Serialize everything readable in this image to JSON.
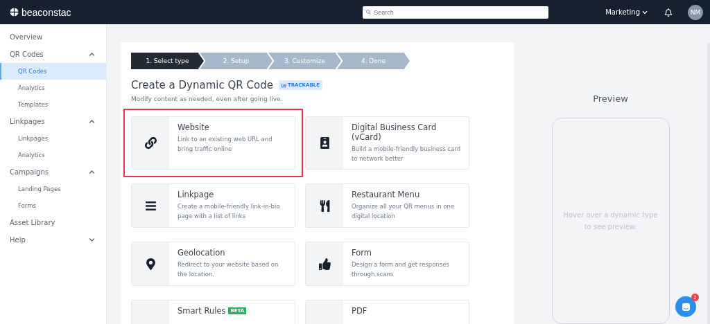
{
  "header": {
    "logo": "beaconstac",
    "search": {
      "placeholder": "Search"
    },
    "workspace": "Marketing",
    "avatar": "NM"
  },
  "sidebar": {
    "items": [
      {
        "label": "Overview"
      },
      {
        "label": "QR Codes",
        "expanded": true,
        "children": [
          {
            "label": "QR Codes",
            "selected": true
          },
          {
            "label": "Analytics",
            "selected": false
          },
          {
            "label": "Templates",
            "selected": false
          }
        ]
      },
      {
        "label": "Linkpages",
        "expanded": true,
        "children": [
          {
            "label": "Linkpages",
            "selected": false
          },
          {
            "label": "Analytics",
            "selected": false
          }
        ]
      },
      {
        "label": "Campaigns",
        "expanded": true,
        "children": [
          {
            "label": "Landing Pages",
            "selected": false
          },
          {
            "label": "Forms",
            "selected": false
          }
        ]
      },
      {
        "label": "Asset Library"
      },
      {
        "label": "Help",
        "expanded": false
      }
    ]
  },
  "steps": [
    {
      "label": "1. Select type",
      "selected": true
    },
    {
      "label": "2. Setup",
      "selected": false
    },
    {
      "label": "3. Customize",
      "selected": false
    },
    {
      "label": "4. Done",
      "selected": false
    }
  ],
  "title": "Create a Dynamic QR Code",
  "badge": "TRACKABLE",
  "subtitle": "Modify content as needed, even after going live.",
  "types": [
    {
      "kind": "link",
      "title": "Website",
      "description": "Link to an existing web URL and bring traffic online",
      "highlighted": true
    },
    {
      "kind": "vcard",
      "title": "Digital Business Card (vCard)",
      "description": "Build a mobile-friendly business card to network better",
      "highlighted": false
    },
    {
      "kind": "list",
      "title": "Linkpage",
      "description": "Create a mobile-friendly link-in-bio page with a list of links",
      "highlighted": false
    },
    {
      "kind": "menu",
      "title": "Restaurant Menu",
      "description": "Organize all your QR menus in one digital location",
      "highlighted": false
    },
    {
      "kind": "pin",
      "title": "Geolocation",
      "description": "Redirect to your website based on the location.",
      "highlighted": false
    },
    {
      "kind": "form",
      "title": "Form",
      "description": "Design a form and get responses through scans",
      "highlighted": false
    },
    {
      "kind": "rules",
      "title": "Smart Rules",
      "tag": "BETA",
      "highlighted": false
    },
    {
      "kind": "pdf",
      "title": "PDF",
      "highlighted": false
    }
  ],
  "preview": {
    "title": "Preview",
    "hint": "Hover over a dynamic type to see preview."
  },
  "chat": {
    "unread": "2"
  }
}
